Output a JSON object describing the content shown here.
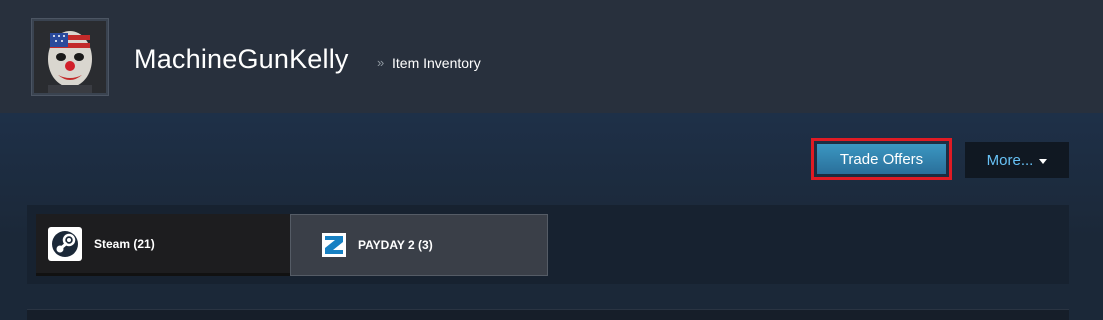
{
  "header": {
    "persona_name": "MachineGunKelly",
    "separator": "»",
    "page_label": "Item Inventory",
    "avatar_icon": "clown-mask-avatar"
  },
  "actions": {
    "trade_offers_label": "Trade Offers",
    "more_label": "More...",
    "highlight_color": "#e01b24"
  },
  "tabs": [
    {
      "label": "Steam (21)",
      "icon": "steam-icon",
      "selected": false
    },
    {
      "label": "PAYDAY 2 (3)",
      "icon": "payday2-icon",
      "selected": true
    }
  ],
  "colors": {
    "background": "#1b2838",
    "header": "#28303d",
    "accent": "#67c1f5",
    "trade_button": "#2a6f9a"
  }
}
